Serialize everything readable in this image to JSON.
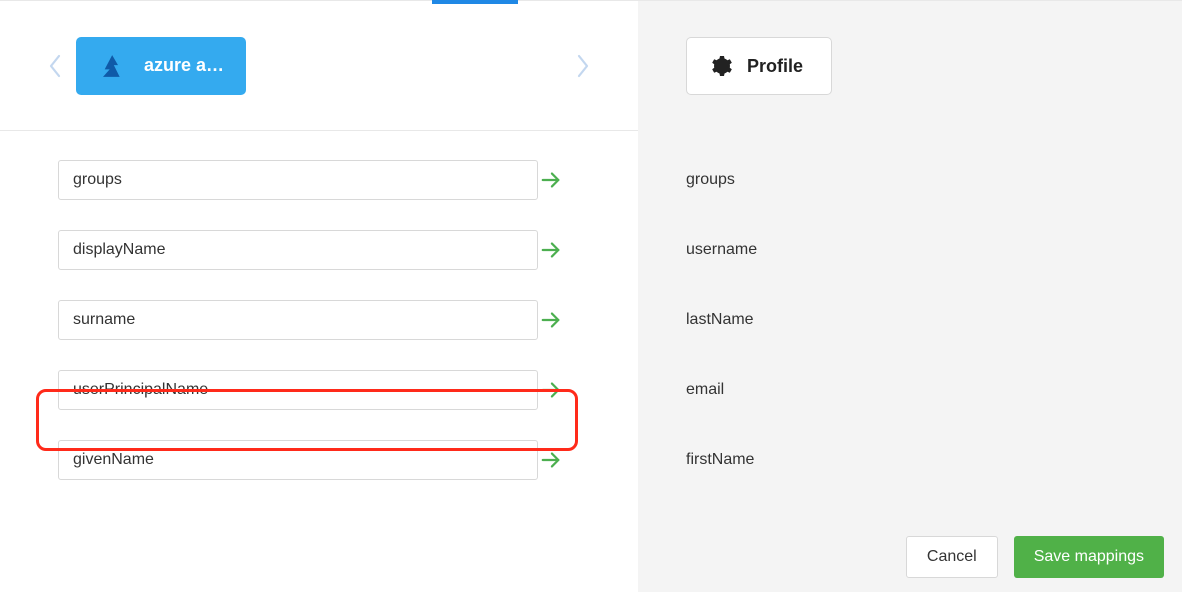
{
  "provider": {
    "label": "azure a…"
  },
  "profile": {
    "label": "Profile"
  },
  "mappings": [
    {
      "source": "groups",
      "target": "groups",
      "highlighted": false
    },
    {
      "source": "displayName",
      "target": "username",
      "highlighted": false
    },
    {
      "source": "surname",
      "target": "lastName",
      "highlighted": false
    },
    {
      "source": "userPrincipalName",
      "target": "email",
      "highlighted": true
    },
    {
      "source": "givenName",
      "target": "firstName",
      "highlighted": false
    }
  ],
  "actions": {
    "cancel": "Cancel",
    "save": "Save mappings"
  }
}
